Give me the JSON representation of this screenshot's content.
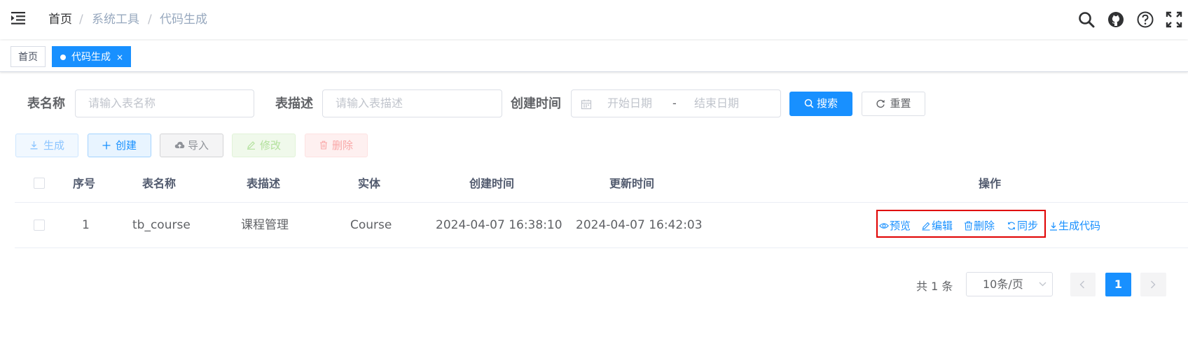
{
  "header": {
    "breadcrumbs": [
      "首页",
      "系统工具",
      "代码生成"
    ]
  },
  "tags": [
    {
      "label": "首页"
    },
    {
      "label": "代码生成",
      "close": "×"
    }
  ],
  "search": {
    "table_name_label": "表名称",
    "table_name_placeholder": "请输入表名称",
    "table_desc_label": "表描述",
    "table_desc_placeholder": "请输入表描述",
    "create_time_label": "创建时间",
    "start_date_placeholder": "开始日期",
    "date_sep": "-",
    "end_date_placeholder": "结束日期",
    "search_button": "搜索",
    "reset_button": "重置"
  },
  "toolbar": {
    "generate": "生成",
    "create": "创建",
    "import": "导入",
    "edit": "修改",
    "delete": "删除"
  },
  "table": {
    "headers": [
      "序号",
      "表名称",
      "表描述",
      "实体",
      "创建时间",
      "更新时间",
      "操作"
    ],
    "rows": [
      {
        "index": "1",
        "table_name": "tb_course",
        "table_desc": "课程管理",
        "entity": "Course",
        "create_time": "2024-04-07 16:38:10",
        "update_time": "2024-04-07 16:42:03",
        "actions": [
          "预览",
          "编辑",
          "删除",
          "同步",
          "生成代码"
        ]
      }
    ]
  },
  "pagination": {
    "total": "共 1 条",
    "page_size": "10条/页",
    "current_page": "1"
  },
  "colors": {
    "primary": "#1890ff",
    "highlight_box": "#e00000"
  }
}
